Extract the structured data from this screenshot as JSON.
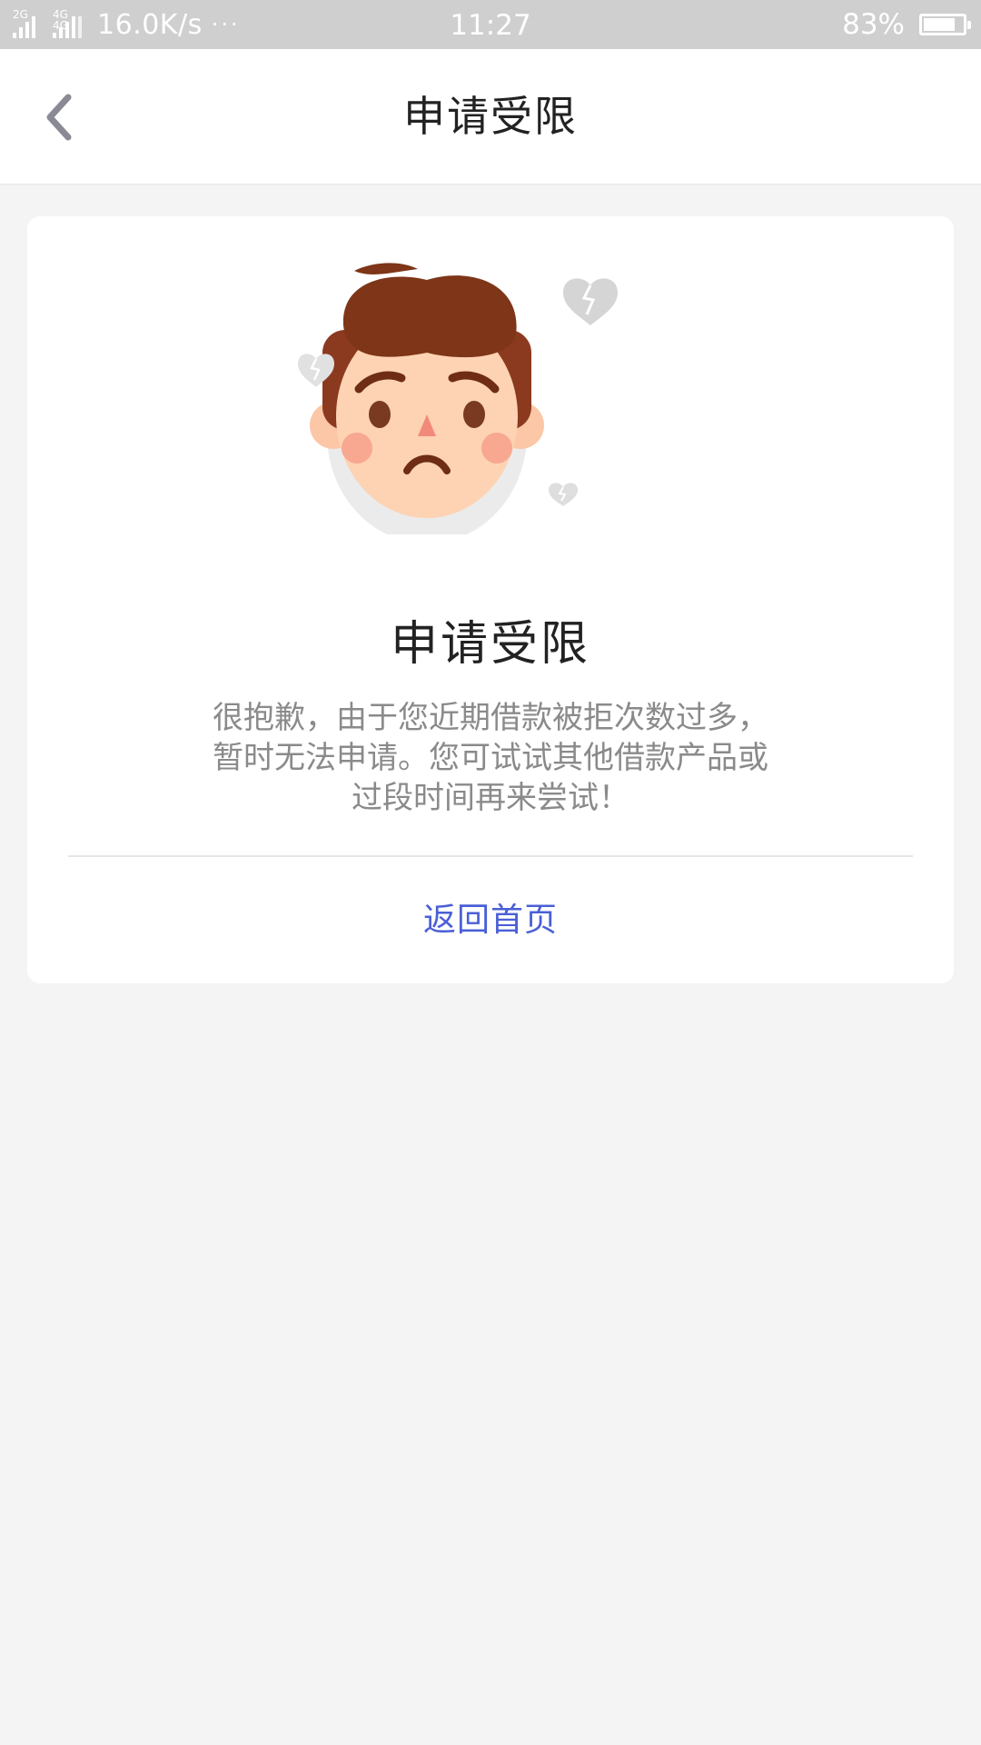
{
  "status_bar": {
    "network_2g": "2G",
    "network_4g": "4G 4G",
    "speed": "16.0K/s",
    "more": "···",
    "time": "11:27",
    "battery_text": "83%",
    "battery_level": 0.83
  },
  "navbar": {
    "title": "申请受限",
    "back_icon": "chevron-left-icon"
  },
  "card": {
    "illustration": "sad-face-with-broken-hearts",
    "heading": "申请受限",
    "message_lines": [
      "很抱歉，由于您近期借款被拒次数过多，",
      "暂时无法申请。您可试试其他借款产品或",
      "过段时间再来尝试！"
    ],
    "home_link": "返回首页"
  },
  "colors": {
    "status_bar_bg": "#cfcfcf",
    "page_bg": "#f4f4f4",
    "link": "#4a5fd6",
    "hair": "#7e3518",
    "skin": "#fdd3b4",
    "cheek": "#f8a791",
    "heart": "#d5d5d5"
  }
}
